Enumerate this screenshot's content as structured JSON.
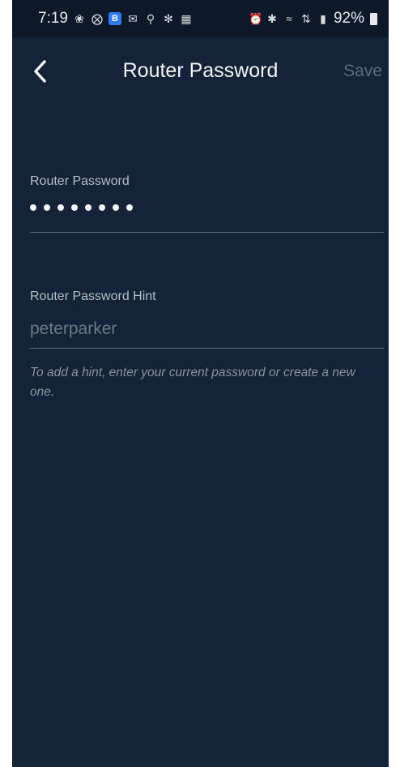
{
  "status_bar": {
    "time": "7:19",
    "battery": "92%",
    "left_icons": [
      "pinwheel-icon",
      "slack-icon",
      "blue-app-icon",
      "mail-icon",
      "trophy-icon",
      "settings-flower-icon",
      "calendar-icon"
    ],
    "right_icons": [
      "alarm-icon",
      "bluetooth-icon",
      "wifi-icon",
      "lte-icon",
      "signal-icon"
    ]
  },
  "header": {
    "title": "Router Password",
    "save_label": "Save"
  },
  "password_field": {
    "label": "Router Password",
    "masked_length": 8
  },
  "hint_field": {
    "label": "Router Password Hint",
    "placeholder": "peterparker"
  },
  "helper_text": "To add a hint, enter your current password or create a new one.",
  "colors": {
    "background": "#142338",
    "status_bar": "#0d1828",
    "text_primary": "#f2f4f7",
    "text_disabled": "#5b6a7e"
  }
}
